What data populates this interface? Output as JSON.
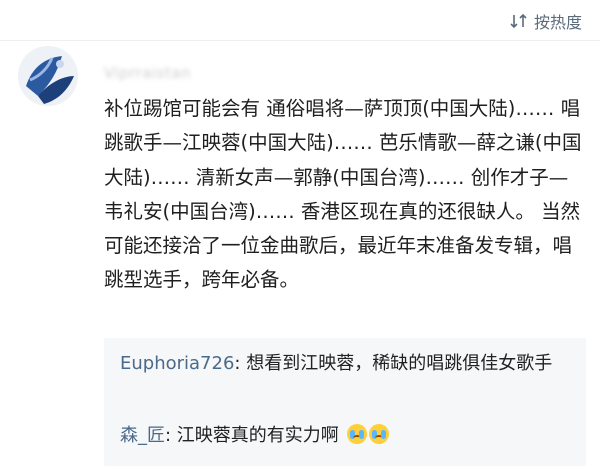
{
  "sort": {
    "label": "按热度",
    "icon": "sort-icon"
  },
  "comment": {
    "username": "Viprraistan",
    "avatar_icon": "avatar-image",
    "text": "补位踢馆可能会有 通俗唱将—萨顶顶(中国大陆)…… 唱跳歌手—江映蓉(中国大陆)…… 芭乐情歌—薛之谦(中国大陆)…… 清新女声—郭静(中国台湾)…… 创作才子—韦礼安(中国台湾)…… 香港区现在真的还很缺人。 当然可能还接洽了一位金曲歌后，最近年末准备发专辑，唱跳型选手，跨年必备。"
  },
  "replies": [
    {
      "name": "Euphoria726",
      "sep": ": ",
      "text": "想看到江映蓉，稀缺的唱跳俱佳女歌手"
    },
    {
      "name": "森_匠",
      "sep": ": ",
      "text": "江映蓉真的有实力啊",
      "emoji": "crying-face-icon"
    }
  ],
  "colors": {
    "link": "#4a6a8a",
    "reply_bg": "#f6f7f9",
    "sort": "#5b6b7c"
  }
}
